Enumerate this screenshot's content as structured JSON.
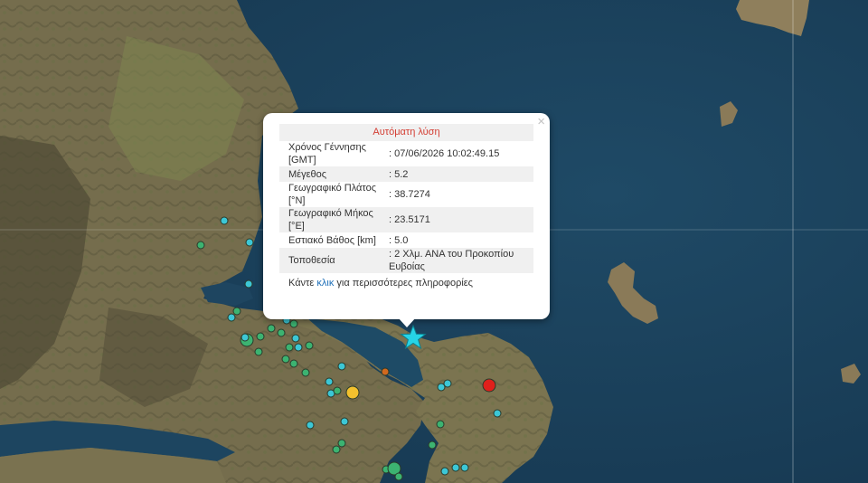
{
  "popup": {
    "title": "Αυτόματη λύση",
    "close_symbol": "×",
    "rows": [
      {
        "label": "Χρόνος Γέννησης [GMT]",
        "value": ": 07/06/2026 10:02:49.15"
      },
      {
        "label": "Μέγεθος",
        "value": ": 5.2"
      },
      {
        "label": "Γεωγραφικό Πλάτος [°N]",
        "value": ": 38.7274"
      },
      {
        "label": "Γεωγραφικό Μήκος [°E]",
        "value": ": 23.5171"
      },
      {
        "label": "Εστιακό Βάθος [km]",
        "value": ": 5.0"
      },
      {
        "label": "Τοποθεσία",
        "value": ": 2 Χλμ. ΑΝΑ του Προκοπίου Ευβοίας"
      }
    ],
    "more_prefix": "Κάντε ",
    "more_link": "κλικ",
    "more_suffix": " για περισσότερες πληροφορίες"
  },
  "colors": {
    "sea": "#1e4560",
    "land": "#6f6a4b",
    "epicenter_star": "#26d4e6",
    "quake_green": "#3cb371",
    "quake_cyan": "#3cc7d6",
    "quake_yellow": "#f2c12e",
    "quake_orange": "#d2691e",
    "quake_red": "#e0201b"
  },
  "map": {
    "epicenter_icon": "star-icon",
    "marker_icon": "circle-icon"
  }
}
